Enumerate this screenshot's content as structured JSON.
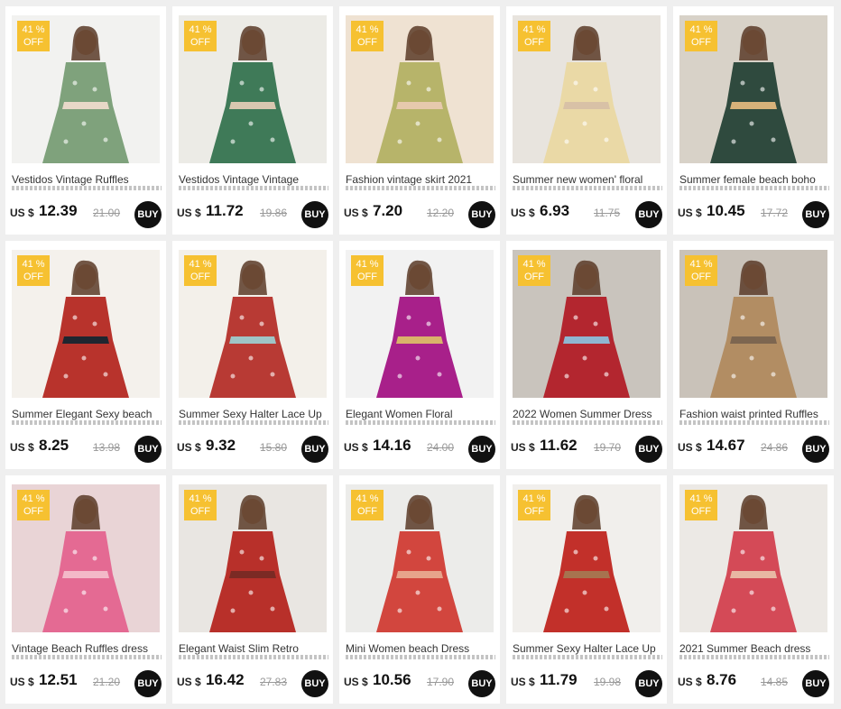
{
  "colors": {
    "badge": "#f6c131",
    "buy": "#111111",
    "page_bg": "#efefef"
  },
  "products": [
    {
      "discount_top": "41 %",
      "discount_bottom": "OFF",
      "title": "Vestidos Vintage Ruffles",
      "currency": "US $",
      "price": "12.39",
      "old_price": "21.00",
      "buy_label": "BUY",
      "palette": [
        "#f2f2f0",
        "#7fa27c",
        "#e8d8c8"
      ]
    },
    {
      "discount_top": "41 %",
      "discount_bottom": "OFF",
      "title": "Vestidos Vintage Vintage",
      "currency": "US $",
      "price": "11.72",
      "old_price": "19.86",
      "buy_label": "BUY",
      "palette": [
        "#ecebe6",
        "#3f7a58",
        "#d9c7b0"
      ]
    },
    {
      "discount_top": "41 %",
      "discount_bottom": "OFF",
      "title": "Fashion vintage skirt 2021",
      "currency": "US $",
      "price": "7.20",
      "old_price": "12.20",
      "buy_label": "BUY",
      "palette": [
        "#efe2d2",
        "#b7b46a",
        "#e6c9ad"
      ]
    },
    {
      "discount_top": "41 %",
      "discount_bottom": "OFF",
      "title": "Summer new women' floral",
      "currency": "US $",
      "price": "6.93",
      "old_price": "11.75",
      "buy_label": "BUY",
      "palette": [
        "#e8e4de",
        "#ead9a6",
        "#d8c1a6"
      ]
    },
    {
      "discount_top": "41 %",
      "discount_bottom": "OFF",
      "title": "Summer female beach boho",
      "currency": "US $",
      "price": "10.45",
      "old_price": "17.72",
      "buy_label": "BUY",
      "palette": [
        "#d8d2c8",
        "#2f4a3e",
        "#d7b27a"
      ]
    },
    {
      "discount_top": "41 %",
      "discount_bottom": "OFF",
      "title": "Summer Elegant Sexy beach",
      "currency": "US $",
      "price": "8.25",
      "old_price": "13.98",
      "buy_label": "BUY",
      "palette": [
        "#f4f1ec",
        "#b8332c",
        "#1f2630"
      ]
    },
    {
      "discount_top": "41 %",
      "discount_bottom": "OFF",
      "title": "Summer Sexy Halter Lace Up",
      "currency": "US $",
      "price": "9.32",
      "old_price": "15.80",
      "buy_label": "BUY",
      "palette": [
        "#f3f0ea",
        "#b83a34",
        "#9fc4c6"
      ]
    },
    {
      "discount_top": "41 %",
      "discount_bottom": "OFF",
      "title": "Elegant Women Floral",
      "currency": "US $",
      "price": "14.16",
      "old_price": "24.00",
      "buy_label": "BUY",
      "palette": [
        "#f2f2f2",
        "#a8208a",
        "#d9b36a"
      ]
    },
    {
      "discount_top": "41 %",
      "discount_bottom": "OFF",
      "title": "2022 Women Summer Dress",
      "currency": "US $",
      "price": "11.62",
      "old_price": "19.70",
      "buy_label": "BUY",
      "palette": [
        "#c9c4bd",
        "#b3262f",
        "#8fb6d1"
      ]
    },
    {
      "discount_top": "41 %",
      "discount_bottom": "OFF",
      "title": "Fashion waist printed Ruffles",
      "currency": "US $",
      "price": "14.67",
      "old_price": "24.86",
      "buy_label": "BUY",
      "palette": [
        "#c9c2b9",
        "#b28d63",
        "#7d6650"
      ]
    },
    {
      "discount_top": "41 %",
      "discount_bottom": "OFF",
      "title": "Vintage Beach Ruffles dress",
      "currency": "US $",
      "price": "12.51",
      "old_price": "21.20",
      "buy_label": "BUY",
      "palette": [
        "#e9d4d6",
        "#e46a93",
        "#f3b9c8"
      ]
    },
    {
      "discount_top": "41 %",
      "discount_bottom": "OFF",
      "title": "Elegant Waist Slim Retro",
      "currency": "US $",
      "price": "16.42",
      "old_price": "27.83",
      "buy_label": "BUY",
      "palette": [
        "#e9e6e2",
        "#b8302a",
        "#7b2a24"
      ]
    },
    {
      "discount_top": "41 %",
      "discount_bottom": "OFF",
      "title": "Mini Women beach Dress",
      "currency": "US $",
      "price": "10.56",
      "old_price": "17.90",
      "buy_label": "BUY",
      "palette": [
        "#ececea",
        "#d2463e",
        "#e7a38b"
      ]
    },
    {
      "discount_top": "41 %",
      "discount_bottom": "OFF",
      "title": "Summer Sexy Halter Lace Up",
      "currency": "US $",
      "price": "11.79",
      "old_price": "19.98",
      "buy_label": "BUY",
      "palette": [
        "#f1efec",
        "#c2302a",
        "#a7734f"
      ]
    },
    {
      "discount_top": "41 %",
      "discount_bottom": "OFF",
      "title": "2021 Summer Beach dress",
      "currency": "US $",
      "price": "8.76",
      "old_price": "14.85",
      "buy_label": "BUY",
      "palette": [
        "#ece9e5",
        "#d44a57",
        "#e8b7a3"
      ]
    }
  ]
}
